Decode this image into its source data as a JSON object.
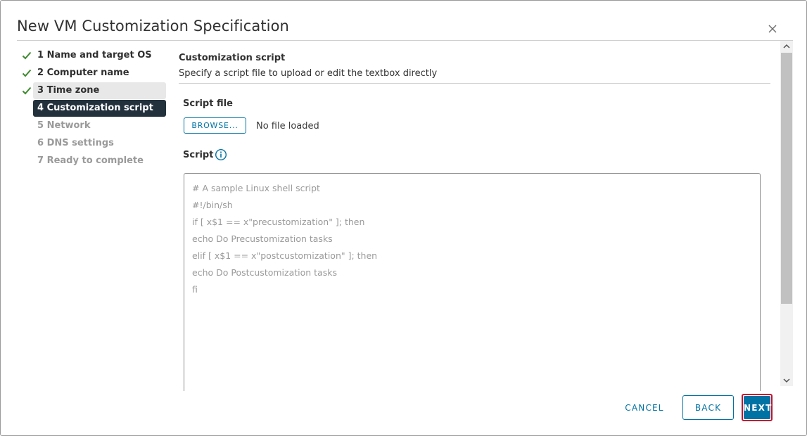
{
  "dialog": {
    "title": "New VM Customization Specification",
    "close_icon": "close-icon"
  },
  "steps": [
    {
      "label": "1 Name and target OS",
      "state": "done"
    },
    {
      "label": "2 Computer name",
      "state": "done"
    },
    {
      "label": "3 Time zone",
      "state": "done-visited"
    },
    {
      "label": "4 Customization script",
      "state": "active"
    },
    {
      "label": "5 Network",
      "state": "pending"
    },
    {
      "label": "6 DNS settings",
      "state": "pending"
    },
    {
      "label": "7 Ready to complete",
      "state": "pending"
    }
  ],
  "main": {
    "title": "Customization script",
    "description": "Specify a script file to upload or edit the textbox directly",
    "script_file_label": "Script file",
    "browse_label": "BROWSE...",
    "file_status": "No file loaded",
    "script_label": "Script",
    "info_icon": "info-icon",
    "script_placeholder_lines": [
      "# A sample Linux shell script",
      "#!/bin/sh",
      "if [ x$1 == x\"precustomization\" ]; then",
      "echo Do Precustomization tasks",
      "elif [ x$1 == x\"postcustomization\" ]; then",
      "echo Do Postcustomization tasks",
      "fi"
    ]
  },
  "footer": {
    "cancel_label": "CANCEL",
    "back_label": "BACK",
    "next_label": "NEXT"
  },
  "colors": {
    "accent": "#0072a3",
    "active_step_bg": "#23313d",
    "check": "#3c8a2e",
    "highlight_border": "#c8102e"
  }
}
